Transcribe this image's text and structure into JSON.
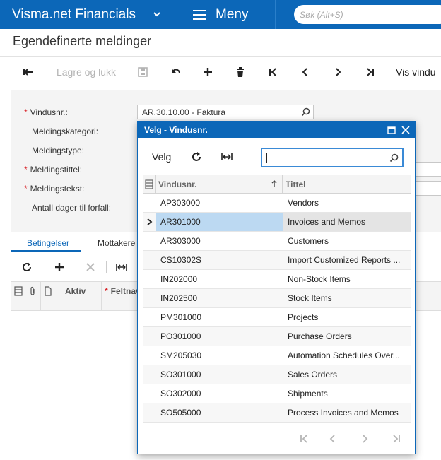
{
  "app": {
    "brand": "Visma.net Financials",
    "menu_label": "Meny",
    "search_placeholder": "Søk (Alt+S)"
  },
  "page": {
    "title": "Egendefinerte meldinger"
  },
  "toolbar": {
    "save_close_label": "Lagre og lukk",
    "show_window_label": "Vis vindu"
  },
  "form": {
    "window_no_label": "Vindusnr.:",
    "window_no_value": "AR.30.10.00 - Faktura",
    "category_label": "Meldingskategori:",
    "type_label": "Meldingstype:",
    "msg_title_label": "Meldingstittel:",
    "msg_text_label": "Meldingstekst:",
    "days_due_label": "Antall dager til forfall:"
  },
  "tabs": {
    "conditions": "Betingelser",
    "recipients": "Mottakere"
  },
  "grid": {
    "col_active": "Aktiv",
    "col_field": "Feltnav"
  },
  "modal": {
    "title": "Velg - Vindusnr.",
    "select_label": "Velg",
    "search_value": "",
    "col_window": "Vindusnr.",
    "col_title": "Tittel",
    "rows": [
      {
        "id": "AP303000",
        "title": "Vendors"
      },
      {
        "id": "AR301000",
        "title": "Invoices and Memos"
      },
      {
        "id": "AR303000",
        "title": "Customers"
      },
      {
        "id": "CS10302S",
        "title": "Import Customized Reports ..."
      },
      {
        "id": "IN202000",
        "title": "Non-Stock Items"
      },
      {
        "id": "IN202500",
        "title": "Stock Items"
      },
      {
        "id": "PM301000",
        "title": "Projects"
      },
      {
        "id": "PO301000",
        "title": "Purchase Orders"
      },
      {
        "id": "SM205030",
        "title": "Automation Schedules Over..."
      },
      {
        "id": "SO301000",
        "title": "Sales Orders"
      },
      {
        "id": "SO302000",
        "title": "Shipments"
      },
      {
        "id": "SO505000",
        "title": "Process Invoices and Memos"
      }
    ]
  },
  "colors": {
    "brand_blue": "#0c67b8",
    "selected_row": "#bcd9f2",
    "required": "#d9252b"
  }
}
